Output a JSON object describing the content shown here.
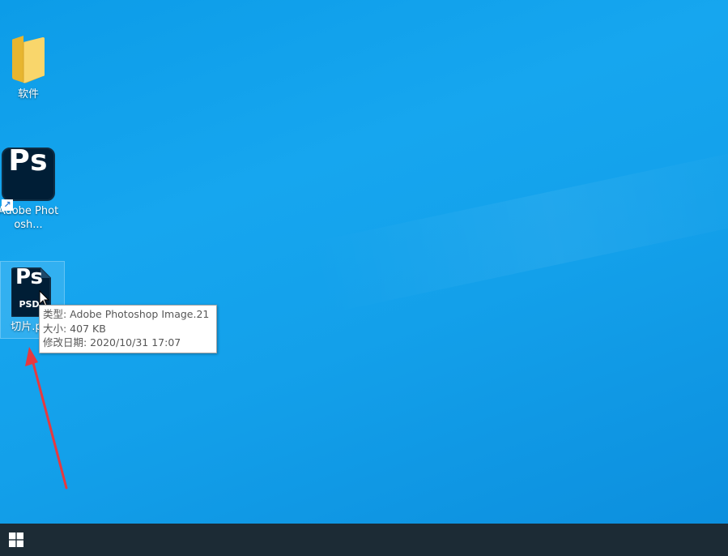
{
  "desktop": {
    "icons": [
      {
        "label": "软件",
        "icon": "folder-icon"
      },
      {
        "label": "Adobe Photosh...",
        "icon": "photoshop-app-icon",
        "glyph": "Ps"
      },
      {
        "label": "切片.psd",
        "icon": "psd-file-icon",
        "glyph": "Ps",
        "tag": "PSD"
      }
    ]
  },
  "tooltip": {
    "type_line": "类型: Adobe Photoshop Image.21",
    "size_line": "大小: 407 KB",
    "date_line": "修改日期: 2020/10/31 17:07"
  },
  "taskbar": {
    "start_icon": "windows-logo-icon"
  },
  "colors": {
    "desktop_background": "#13a0ea",
    "photoshop_tile": "#001e36",
    "taskbar": "#1c2b35",
    "annotation_arrow": "#e6393f"
  }
}
